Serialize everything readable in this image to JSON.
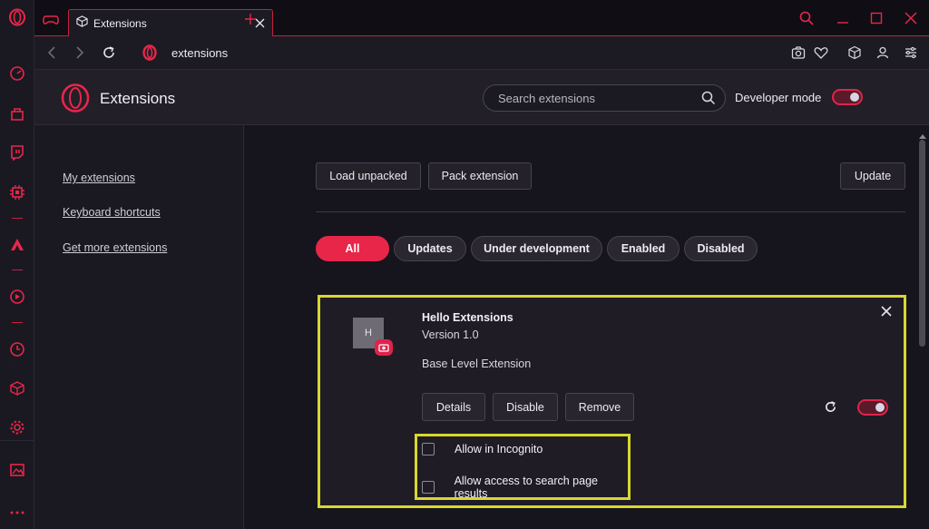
{
  "titlebar": {
    "tab_title": "Extensions"
  },
  "address": {
    "url": "extensions"
  },
  "header": {
    "title": "Extensions",
    "search_placeholder": "Search extensions",
    "developer_mode_label": "Developer mode",
    "developer_mode_on": true
  },
  "nav": {
    "links": [
      "My extensions",
      "Keyboard shortcuts",
      "Get more extensions"
    ]
  },
  "toolbar": {
    "load_unpacked": "Load unpacked",
    "pack_extension": "Pack extension",
    "update": "Update"
  },
  "filters": [
    "All",
    "Updates",
    "Under development",
    "Enabled",
    "Disabled"
  ],
  "active_filter": "All",
  "extension": {
    "icon_letter": "H",
    "name": "Hello Extensions",
    "version": "Version 1.0",
    "description": "Base Level Extension",
    "details_label": "Details",
    "disable_label": "Disable",
    "remove_label": "Remove",
    "enabled": true,
    "options": [
      {
        "label": "Allow in Incognito",
        "checked": false
      },
      {
        "label": "Allow access to search page results",
        "checked": false
      }
    ]
  },
  "colors": {
    "accent": "#e8264a",
    "highlight": "#d8d630",
    "background": "#16141c"
  }
}
